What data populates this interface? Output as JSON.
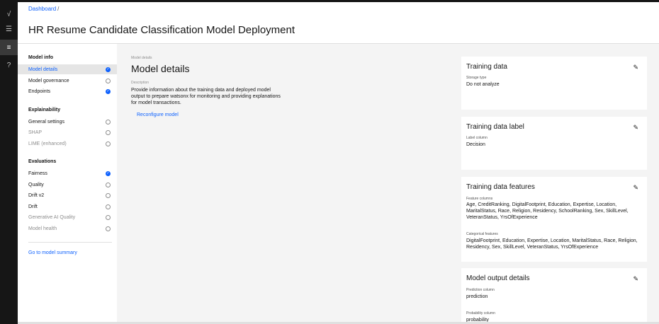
{
  "breadcrumb": {
    "link": "Dashboard",
    "sep": "/"
  },
  "page_title": "HR Resume Candidate Classification Model Deployment",
  "rail": [
    {
      "name": "activity-icon",
      "glyph": "√"
    },
    {
      "name": "deployments-icon",
      "glyph": "☰"
    },
    {
      "name": "configure-icon",
      "glyph": "≡"
    },
    {
      "name": "help-icon",
      "glyph": "?"
    }
  ],
  "sidebar": {
    "model_info": "Model info",
    "model_details": "Model details",
    "model_governance": "Model governance",
    "endpoints": "Endpoints",
    "explainability": "Explainability",
    "general_settings": "General settings",
    "shap": "SHAP",
    "lime": "LIME (enhanced)",
    "evaluations": "Evaluations",
    "fairness": "Fairness",
    "quality": "Quality",
    "drift_v2": "Drift v2",
    "drift": "Drift",
    "gen_ai_quality": "Generative AI Quality",
    "model_health": "Model health",
    "summary_link": "Go to model summary",
    "check": "✓"
  },
  "main": {
    "breadcrumb_label": "Model details",
    "title": "Model details",
    "description_label": "Description",
    "description": "Provide information about the training data and deployed model output to prepare watsonx for monitoring and providing explanations for model transactions.",
    "reconfigure": "Reconfigure model"
  },
  "cards": {
    "edit_glyph": "✎",
    "training_data": {
      "title": "Training data",
      "label": "Storage type",
      "value": "Do not analyze"
    },
    "training_label": {
      "title": "Training data label",
      "label": "Label column",
      "value": "Decision"
    },
    "features": {
      "title": "Training data features",
      "feature_label": "Feature columns",
      "feature_value": "Age, CreditRanking, DigitalFootprint, Education, Expertise, Location, MaritalStatus, Race, Religion, Residency, SchoolRanking, Sex, SkillLevel, VeteranStatus, YrsOfExperience",
      "categorical_label": "Categorical features",
      "categorical_value": "DigitalFootprint, Education, Expertise, Location, MaritalStatus, Race, Religion, Residency, Sex, SkillLevel, VeteranStatus, YrsOfExperience"
    },
    "output": {
      "title": "Model output details",
      "prediction_label": "Prediction column",
      "prediction_value": "prediction",
      "probability_label": "Probability column",
      "probability_value": "probability"
    }
  }
}
